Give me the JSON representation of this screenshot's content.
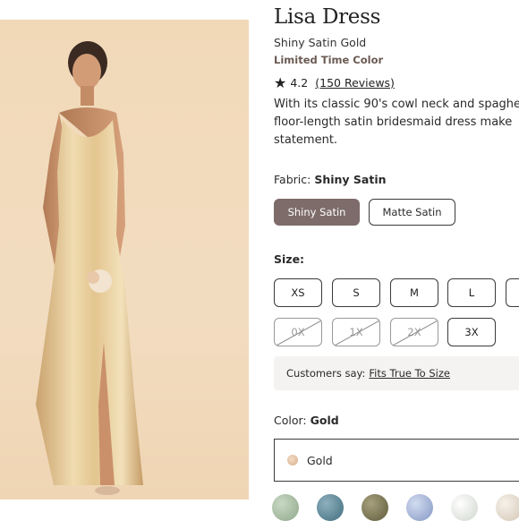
{
  "product": {
    "title": "Lisa Dress",
    "subtitle": "Shiny Satin Gold",
    "tag": "Limited Time Color",
    "rating_value": "4.2",
    "reviews_label": "(150 Reviews)",
    "description_lines": [
      "With its classic 90's cowl neck and spaghe",
      "floor-length satin bridesmaid dress make",
      "statement."
    ]
  },
  "fabric": {
    "label": "Fabric:",
    "selected": "Shiny Satin",
    "options": [
      "Shiny Satin",
      "Matte Satin"
    ]
  },
  "size": {
    "label": "Size:",
    "options": [
      {
        "label": "XS",
        "available": true
      },
      {
        "label": "S",
        "available": true
      },
      {
        "label": "M",
        "available": true
      },
      {
        "label": "L",
        "available": true
      },
      {
        "label": "0X",
        "available": false
      },
      {
        "label": "1X",
        "available": false
      },
      {
        "label": "2X",
        "available": false
      },
      {
        "label": "3X",
        "available": true
      }
    ]
  },
  "fit_note": {
    "prefix": "Customers say:",
    "link": "Fits True To Size"
  },
  "color": {
    "label": "Color:",
    "selected": "Gold",
    "dropdown_value": "Gold",
    "swatches": [
      "#a9bfa5",
      "#5f8a99",
      "#7f7a5a",
      "#a9b8d8",
      "#e6e9e4",
      "#e8e0d4"
    ]
  },
  "colors": {
    "selected_chip": "#7d6c6a",
    "gold_dress": "#e7cf9d",
    "background": "#f1d9b8"
  }
}
